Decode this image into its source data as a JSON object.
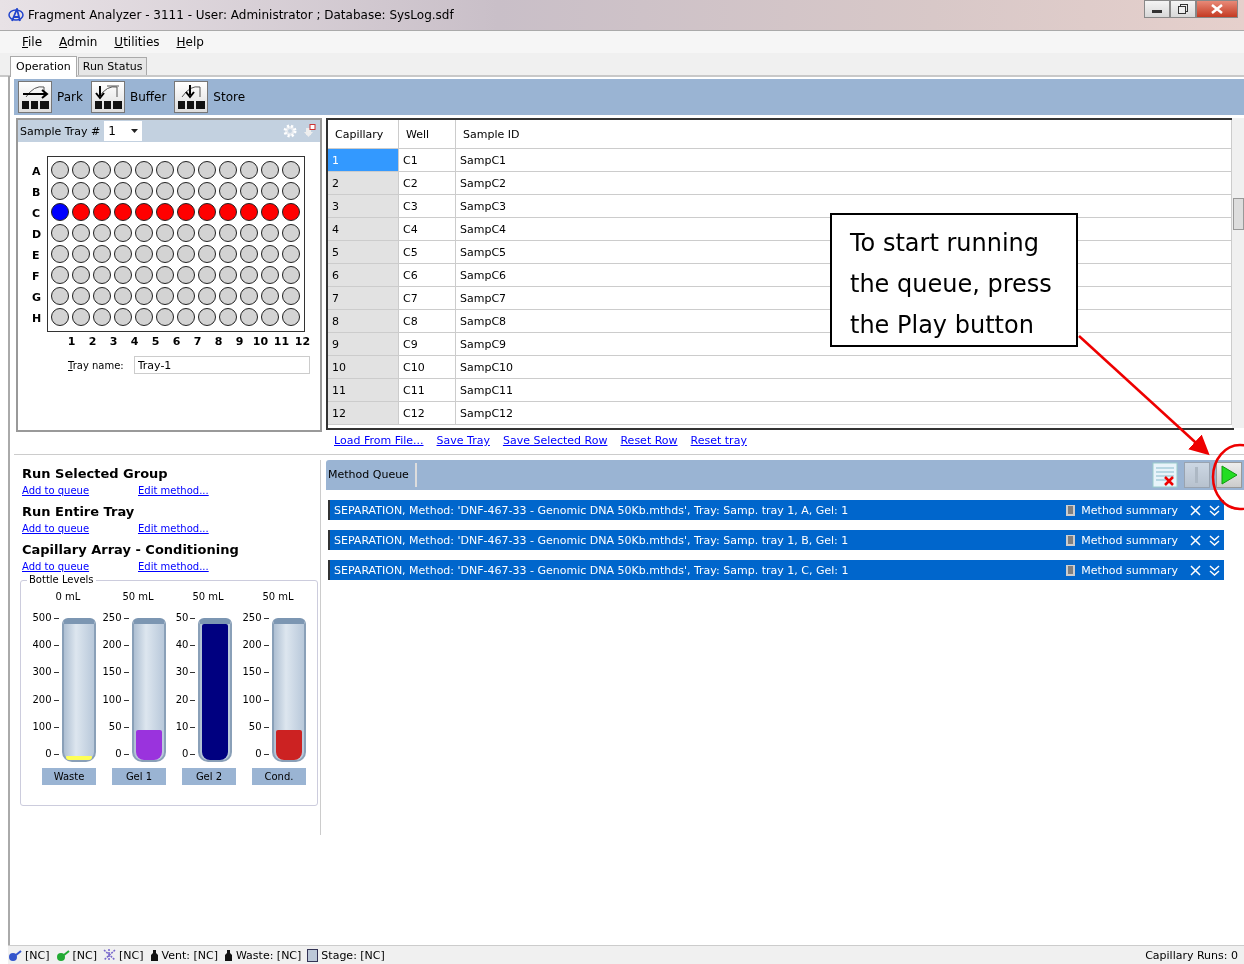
{
  "window": {
    "title": "Fragment Analyzer - 3111 - User: Administrator ; Database: SysLog.sdf"
  },
  "menu": [
    "File",
    "Admin",
    "Utilities",
    "Help"
  ],
  "tabs": [
    {
      "label": "Operation",
      "selected": true
    },
    {
      "label": "Run Status",
      "selected": false
    }
  ],
  "toolbar": [
    {
      "kind": "park",
      "label": "Park"
    },
    {
      "kind": "buffer",
      "label": "Buffer"
    },
    {
      "kind": "store",
      "label": "Store"
    }
  ],
  "sample_tray": {
    "label": "Sample Tray #",
    "number": "1",
    "columns": [
      "1",
      "2",
      "3",
      "4",
      "5",
      "6",
      "7",
      "8",
      "9",
      "10",
      "11",
      "12"
    ],
    "tray_name_label": "Tray name:",
    "tray_name": "Tray-1",
    "rows": [
      {
        "label": "A",
        "wells": [
          {
            "color": "#d3d3d3"
          },
          {
            "color": "#d3d3d3"
          },
          {
            "color": "#d3d3d3"
          },
          {
            "color": "#d3d3d3"
          },
          {
            "color": "#d3d3d3"
          },
          {
            "color": "#d3d3d3"
          },
          {
            "color": "#d3d3d3"
          },
          {
            "color": "#d3d3d3"
          },
          {
            "color": "#d3d3d3"
          },
          {
            "color": "#d3d3d3"
          },
          {
            "color": "#d3d3d3"
          },
          {
            "color": "#d3d3d3"
          }
        ]
      },
      {
        "label": "B",
        "wells": [
          {
            "color": "#d3d3d3"
          },
          {
            "color": "#d3d3d3"
          },
          {
            "color": "#d3d3d3"
          },
          {
            "color": "#d3d3d3"
          },
          {
            "color": "#d3d3d3"
          },
          {
            "color": "#d3d3d3"
          },
          {
            "color": "#d3d3d3"
          },
          {
            "color": "#d3d3d3"
          },
          {
            "color": "#d3d3d3"
          },
          {
            "color": "#d3d3d3"
          },
          {
            "color": "#d3d3d3"
          },
          {
            "color": "#d3d3d3"
          }
        ]
      },
      {
        "label": "C",
        "wells": [
          {
            "color": "#0000ff"
          },
          {
            "color": "#ff0000"
          },
          {
            "color": "#ff0000"
          },
          {
            "color": "#ff0000"
          },
          {
            "color": "#ff0000"
          },
          {
            "color": "#ff0000"
          },
          {
            "color": "#ff0000"
          },
          {
            "color": "#ff0000"
          },
          {
            "color": "#ff0000"
          },
          {
            "color": "#ff0000"
          },
          {
            "color": "#ff0000"
          },
          {
            "color": "#ff0000"
          }
        ]
      },
      {
        "label": "D",
        "wells": [
          {
            "color": "#d3d3d3"
          },
          {
            "color": "#d3d3d3"
          },
          {
            "color": "#d3d3d3"
          },
          {
            "color": "#d3d3d3"
          },
          {
            "color": "#d3d3d3"
          },
          {
            "color": "#d3d3d3"
          },
          {
            "color": "#d3d3d3"
          },
          {
            "color": "#d3d3d3"
          },
          {
            "color": "#d3d3d3"
          },
          {
            "color": "#d3d3d3"
          },
          {
            "color": "#d3d3d3"
          },
          {
            "color": "#d3d3d3"
          }
        ]
      },
      {
        "label": "E",
        "wells": [
          {
            "color": "#d3d3d3"
          },
          {
            "color": "#d3d3d3"
          },
          {
            "color": "#d3d3d3"
          },
          {
            "color": "#d3d3d3"
          },
          {
            "color": "#d3d3d3"
          },
          {
            "color": "#d3d3d3"
          },
          {
            "color": "#d3d3d3"
          },
          {
            "color": "#d3d3d3"
          },
          {
            "color": "#d3d3d3"
          },
          {
            "color": "#d3d3d3"
          },
          {
            "color": "#d3d3d3"
          },
          {
            "color": "#d3d3d3"
          }
        ]
      },
      {
        "label": "F",
        "wells": [
          {
            "color": "#d3d3d3"
          },
          {
            "color": "#d3d3d3"
          },
          {
            "color": "#d3d3d3"
          },
          {
            "color": "#d3d3d3"
          },
          {
            "color": "#d3d3d3"
          },
          {
            "color": "#d3d3d3"
          },
          {
            "color": "#d3d3d3"
          },
          {
            "color": "#d3d3d3"
          },
          {
            "color": "#d3d3d3"
          },
          {
            "color": "#d3d3d3"
          },
          {
            "color": "#d3d3d3"
          },
          {
            "color": "#d3d3d3"
          }
        ]
      },
      {
        "label": "G",
        "wells": [
          {
            "color": "#d3d3d3"
          },
          {
            "color": "#d3d3d3"
          },
          {
            "color": "#d3d3d3"
          },
          {
            "color": "#d3d3d3"
          },
          {
            "color": "#d3d3d3"
          },
          {
            "color": "#d3d3d3"
          },
          {
            "color": "#d3d3d3"
          },
          {
            "color": "#d3d3d3"
          },
          {
            "color": "#d3d3d3"
          },
          {
            "color": "#d3d3d3"
          },
          {
            "color": "#d3d3d3"
          },
          {
            "color": "#d3d3d3"
          }
        ]
      },
      {
        "label": "H",
        "wells": [
          {
            "color": "#d3d3d3"
          },
          {
            "color": "#d3d3d3"
          },
          {
            "color": "#d3d3d3"
          },
          {
            "color": "#d3d3d3"
          },
          {
            "color": "#d3d3d3"
          },
          {
            "color": "#d3d3d3"
          },
          {
            "color": "#d3d3d3"
          },
          {
            "color": "#d3d3d3"
          },
          {
            "color": "#d3d3d3"
          },
          {
            "color": "#d3d3d3"
          },
          {
            "color": "#d3d3d3"
          },
          {
            "color": "#d3d3d3"
          }
        ]
      }
    ]
  },
  "table": {
    "columns": [
      "Capillary",
      "Well",
      "Sample ID"
    ],
    "rows": [
      {
        "capillary": "1",
        "well": "C1",
        "sample_id": "SampC1",
        "selected": true
      },
      {
        "capillary": "2",
        "well": "C2",
        "sample_id": "SampC2",
        "selected": false
      },
      {
        "capillary": "3",
        "well": "C3",
        "sample_id": "SampC3",
        "selected": false
      },
      {
        "capillary": "4",
        "well": "C4",
        "sample_id": "SampC4",
        "selected": false
      },
      {
        "capillary": "5",
        "well": "C5",
        "sample_id": "SampC5",
        "selected": false
      },
      {
        "capillary": "6",
        "well": "C6",
        "sample_id": "SampC6",
        "selected": false
      },
      {
        "capillary": "7",
        "well": "C7",
        "sample_id": "SampC7",
        "selected": false
      },
      {
        "capillary": "8",
        "well": "C8",
        "sample_id": "SampC8",
        "selected": false
      },
      {
        "capillary": "9",
        "well": "C9",
        "sample_id": "SampC9",
        "selected": false
      },
      {
        "capillary": "10",
        "well": "C10",
        "sample_id": "SampC10",
        "selected": false
      },
      {
        "capillary": "11",
        "well": "C11",
        "sample_id": "SampC11",
        "selected": false
      },
      {
        "capillary": "12",
        "well": "C12",
        "sample_id": "SampC12",
        "selected": false
      }
    ]
  },
  "table_links": [
    "Load From File...",
    "Save Tray",
    "Save Selected Row",
    "Reset Row",
    "Reset tray"
  ],
  "run_groups": [
    {
      "title": "Run Selected Group",
      "links": [
        "Add to queue",
        "Edit method..."
      ]
    },
    {
      "title": "Run Entire Tray",
      "links": [
        "Add to queue",
        "Edit method..."
      ]
    },
    {
      "title": "Capillary Array - Conditioning",
      "links": [
        "Add to queue",
        "Edit method..."
      ]
    }
  ],
  "bottle_levels": {
    "title": "Bottle Levels",
    "bottles": [
      {
        "reading": "0 mL",
        "scale": [
          "500",
          "400",
          "300",
          "200",
          "100",
          "0"
        ],
        "level": 0.03,
        "color": "#ffff55",
        "name": "Waste"
      },
      {
        "reading": "50 mL",
        "scale": [
          "250",
          "200",
          "150",
          "100",
          "50",
          "0"
        ],
        "level": 0.22,
        "color": "#9a33dd",
        "name": "Gel 1"
      },
      {
        "reading": "50 mL",
        "scale": [
          "50",
          "40",
          "30",
          "20",
          "10",
          "0"
        ],
        "level": 1.0,
        "color": "#000080",
        "name": "Gel 2"
      },
      {
        "reading": "50 mL",
        "scale": [
          "250",
          "200",
          "150",
          "100",
          "50",
          "0"
        ],
        "level": 0.22,
        "color": "#cc2222",
        "name": "Cond."
      }
    ]
  },
  "method_queue": {
    "title": "Method Queue",
    "items": [
      {
        "text": "SEPARATION, Method: 'DNF-467-33 - Genomic DNA 50Kb.mthds', Tray: Samp. tray 1, A, Gel: 1",
        "summary": "Method summary"
      },
      {
        "text": "SEPARATION, Method: 'DNF-467-33 - Genomic DNA 50Kb.mthds', Tray: Samp. tray 1, B, Gel: 1",
        "summary": "Method summary"
      },
      {
        "text": "SEPARATION, Method: 'DNF-467-33 - Genomic DNA 50Kb.mthds', Tray: Samp. tray 1, C, Gel: 1",
        "summary": "Method summary"
      }
    ]
  },
  "callout": {
    "text": "To start running the queue, press the Play button"
  },
  "status_bar": {
    "items": [
      {
        "kind": "detector",
        "label": "[NC]"
      },
      {
        "kind": "lamp",
        "label": "[NC]"
      },
      {
        "kind": "laser",
        "label": "[NC]"
      },
      {
        "kind": "bottle",
        "label": "Vent: [NC]"
      },
      {
        "kind": "bottle",
        "label": "Waste: [NC]"
      },
      {
        "kind": "stage",
        "label": "Stage: [NC]"
      }
    ],
    "capillary_runs": "Capillary Runs: 0"
  }
}
